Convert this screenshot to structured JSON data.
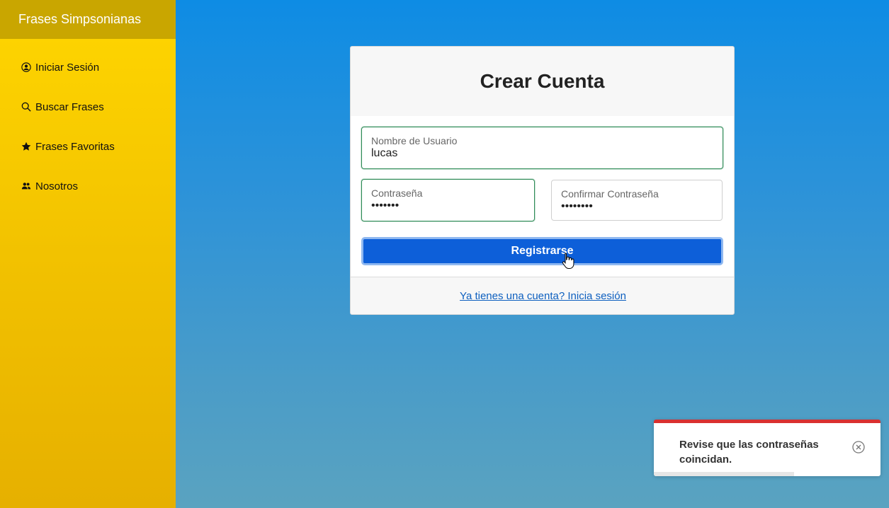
{
  "sidebar": {
    "brand": "Frases Simpsonianas",
    "items": [
      {
        "label": "Iniciar Sesión",
        "icon": "user-circle-icon"
      },
      {
        "label": "Buscar Frases",
        "icon": "search-icon"
      },
      {
        "label": "Frases Favoritas",
        "icon": "star-icon"
      },
      {
        "label": "Nosotros",
        "icon": "people-icon"
      }
    ]
  },
  "card": {
    "title": "Crear Cuenta",
    "username": {
      "label": "Nombre de Usuario",
      "value": "lucas"
    },
    "password": {
      "label": "Contraseña",
      "value": "lucas12"
    },
    "confirm": {
      "label": "Confirmar Contraseña",
      "value": "lucas123"
    },
    "submit_label": "Registrarse",
    "login_link": "Ya tienes una cuenta? Inicia sesión"
  },
  "toast": {
    "message": "Revise que las contraseñas coincidan.",
    "progress": 0.62,
    "accent": "#d93030"
  },
  "colors": {
    "sidebar": "#ffd600",
    "brand_bar": "#c9a600",
    "primary": "#0d5fd9",
    "valid": "#2e8b57"
  }
}
